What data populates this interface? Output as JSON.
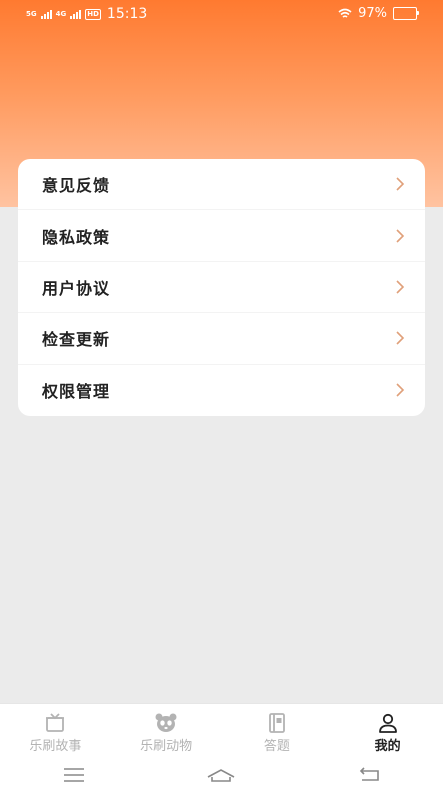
{
  "status_bar": {
    "net1": "5G",
    "net2": "4G",
    "hd": "HD",
    "time": "15:13",
    "battery": "97%",
    "battery_level": 0.97
  },
  "menu": {
    "items": [
      {
        "label": "意见反馈"
      },
      {
        "label": "隐私政策"
      },
      {
        "label": "用户协议"
      },
      {
        "label": "检查更新"
      },
      {
        "label": "权限管理"
      }
    ]
  },
  "tabs": [
    {
      "label": "乐刷故事",
      "icon": "story-box-icon",
      "active": false
    },
    {
      "label": "乐刷动物",
      "icon": "panda-icon",
      "active": false
    },
    {
      "label": "答题",
      "icon": "quiz-book-icon",
      "active": false
    },
    {
      "label": "我的",
      "icon": "person-icon",
      "active": true
    }
  ],
  "colors": {
    "accent": "#ff7a30",
    "chevron": "#e0a07a",
    "inactive_tab": "#b3b3b3",
    "active_tab": "#222222"
  }
}
